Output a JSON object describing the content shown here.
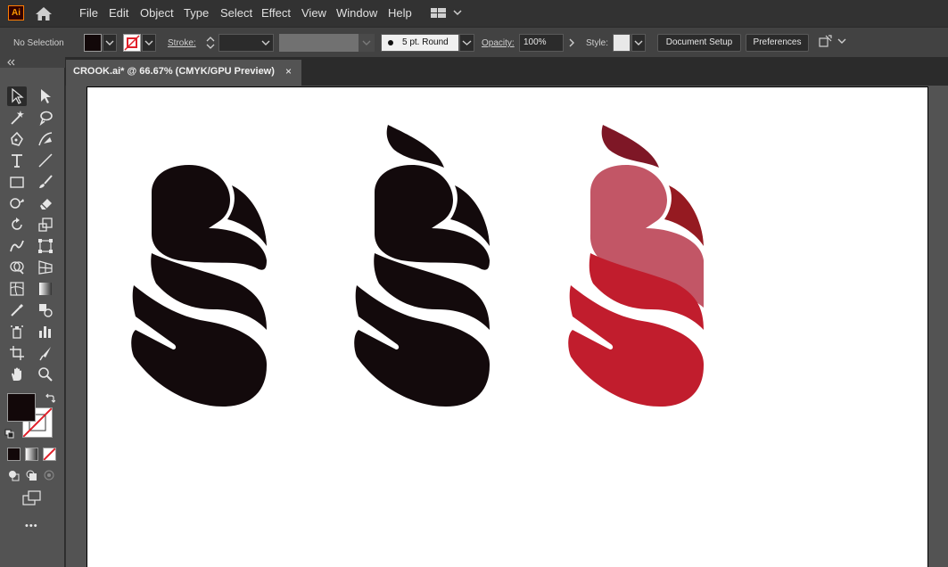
{
  "app": {
    "logo_text": "Ai"
  },
  "menu": [
    "File",
    "Edit",
    "Object",
    "Type",
    "Select",
    "Effect",
    "View",
    "Window",
    "Help"
  ],
  "control": {
    "selection_status": "No Selection",
    "stroke_label": "Stroke:",
    "brush_value": "5 pt. Round",
    "opacity_label": "Opacity:",
    "opacity_value": "100%",
    "style_label": "Style:",
    "document_setup": "Document Setup",
    "preferences": "Preferences"
  },
  "document": {
    "tab_title": "CROOK.ai* @ 66.67% (CMYK/GPU Preview)",
    "close_glyph": "×"
  },
  "colors": {
    "fill": "#120809",
    "dark_mark": "#130a0c",
    "pink": "#c25666",
    "red": "#c11d2d",
    "maroon": "#7e1726",
    "deep_red": "#951a21"
  },
  "toolbar": {
    "more_glyph": "•••",
    "tools": [
      "selection-tool",
      "direct-selection-tool",
      "magic-wand-tool",
      "lasso-tool",
      "pen-tool",
      "curvature-tool",
      "type-tool",
      "line-tool",
      "rectangle-tool",
      "paintbrush-tool",
      "shaper-tool",
      "eraser-tool",
      "rotate-tool",
      "scale-tool",
      "warp-tool",
      "free-transform-tool",
      "shape-builder-tool",
      "perspective-grid-tool",
      "mesh-tool",
      "gradient-tool",
      "eyedropper-tool",
      "blend-tool",
      "symbol-sprayer-tool",
      "column-graph-tool",
      "artboard-tool",
      "slice-tool",
      "hand-tool",
      "zoom-tool"
    ]
  }
}
